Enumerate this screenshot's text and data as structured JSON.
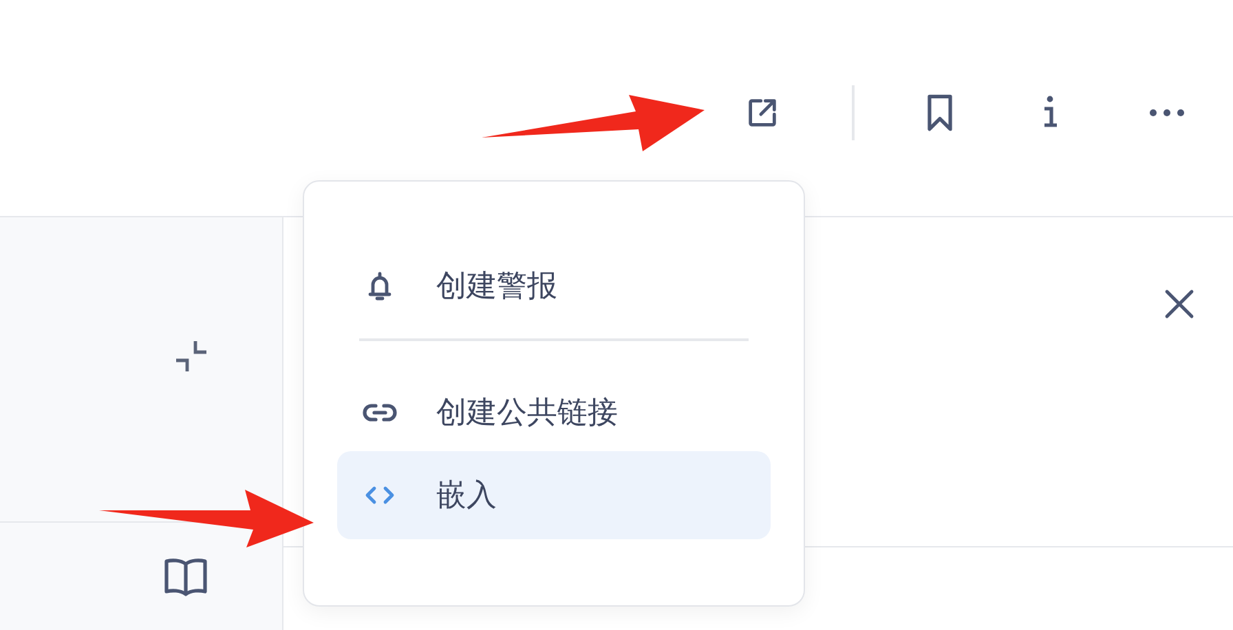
{
  "menu": {
    "groups": [
      [
        {
          "kind": "alert",
          "label": "创建警报",
          "selected": false
        }
      ],
      [
        {
          "kind": "link",
          "label": "创建公共链接",
          "selected": false
        },
        {
          "kind": "embed",
          "label": "嵌入",
          "selected": true
        }
      ]
    ]
  }
}
